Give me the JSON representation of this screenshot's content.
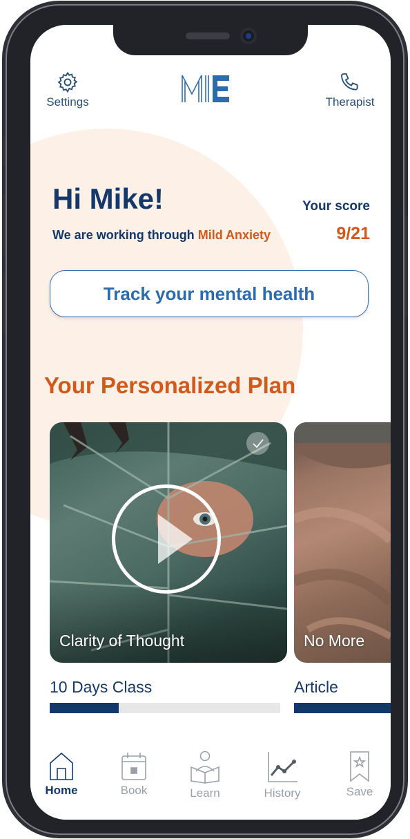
{
  "header": {
    "settings_label": "Settings",
    "therapist_label": "Therapist",
    "logo_text": "ME"
  },
  "greeting": {
    "title": "Hi Mike!",
    "working_prefix": "We are working through",
    "condition": "Mild Anxiety",
    "score_label": "Your score",
    "score_value": "9/21"
  },
  "track_button_label": "Track your mental health",
  "plan": {
    "title": "Your Personalized Plan",
    "cards": [
      {
        "title": "Clarity of Thought",
        "subtitle": "10 Days Class",
        "progress": 0.3,
        "completed": true
      },
      {
        "title": "No More",
        "subtitle": "Article",
        "progress": 1.0
      }
    ]
  },
  "nav": {
    "items": [
      {
        "label": "Home",
        "icon": "home-icon",
        "active": true
      },
      {
        "label": "Book",
        "icon": "calendar-icon"
      },
      {
        "label": "Learn",
        "icon": "learn-icon"
      },
      {
        "label": "History",
        "icon": "chart-icon"
      },
      {
        "label": "Save",
        "icon": "bookmark-icon"
      }
    ]
  },
  "colors": {
    "primary": "#14386a",
    "accent": "#d1591b",
    "button_text": "#2b6cb0",
    "blob": "#fdf0e6"
  }
}
